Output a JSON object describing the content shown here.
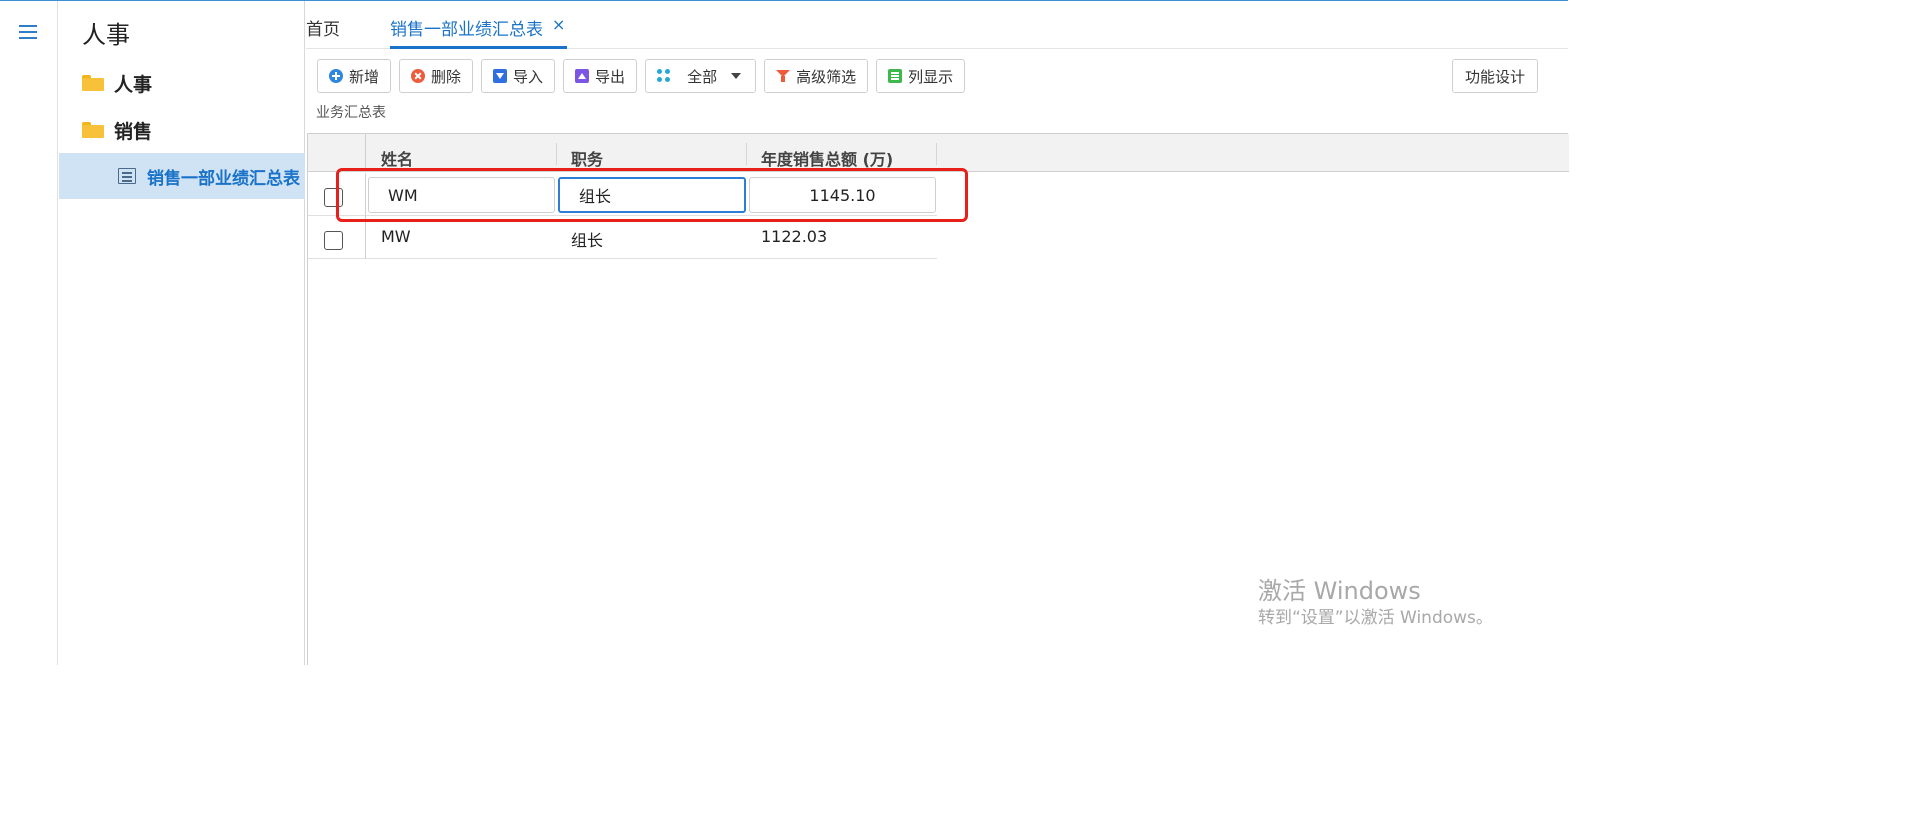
{
  "sidebar": {
    "title": "人事",
    "items": [
      {
        "label": "人事",
        "icon": "folder-icon"
      },
      {
        "label": "销售",
        "icon": "folder-icon"
      },
      {
        "label": "销售一部业绩汇总表",
        "icon": "list-icon",
        "active": true
      }
    ]
  },
  "tabs": {
    "home": "首页",
    "active": "销售一部业绩汇总表",
    "close": "×"
  },
  "toolbar": {
    "add": "新增",
    "delete": "删除",
    "import": "导入",
    "export": "导出",
    "scope": "全部",
    "advanced_filter": "高级筛选",
    "column_display": "列显示",
    "function_design": "功能设计"
  },
  "section_label": "业务汇总表",
  "table": {
    "columns": [
      "姓名",
      "职务",
      "年度销售总额 (万)"
    ],
    "rows": [
      {
        "name": "WM",
        "title": "组长",
        "amount": "1145.10",
        "editing": true
      },
      {
        "name": "MW",
        "title": "组长",
        "amount": "1122.03"
      }
    ]
  },
  "watermark": {
    "line1": "激活 Windows",
    "line2": "转到“设置”以激活 Windows。"
  },
  "colors": {
    "accent": "#1a73c8",
    "highlight_box": "#e8201a",
    "active_nav_bg": "#cfe3f5"
  }
}
